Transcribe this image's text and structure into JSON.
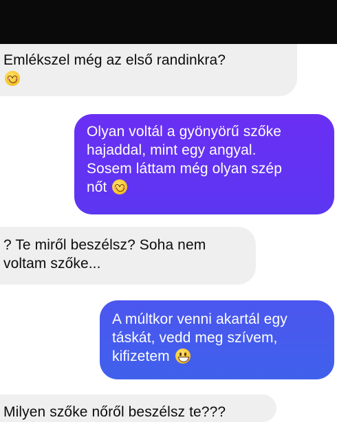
{
  "messages": [
    {
      "from": "them",
      "lines": [
        "Emlékszel még az első randinkra?"
      ],
      "emoji": "smiling-face-with-smiling-eyes"
    },
    {
      "from": "me",
      "lines": [
        "Olyan voltál a gyönyörű szőke",
        "hajaddal, mint egy angyal.",
        "Sosem láttam még olyan szép",
        "nőt"
      ],
      "emoji": "smiling-face-with-smiling-eyes"
    },
    {
      "from": "them",
      "lines": [
        "? Te miről beszélsz? Soha nem",
        "voltam szőke..."
      ]
    },
    {
      "from": "me",
      "lines": [
        "A múltkor venni akartál egy",
        "táskát, vedd meg szívem,",
        "kifizetem"
      ],
      "emoji": "grinning-face"
    },
    {
      "from": "them",
      "lines": [
        "Milyen szőke nőről beszélsz te???"
      ]
    }
  ],
  "colors": {
    "incoming_bubble": "#efefef",
    "outgoing_bubble_1": "#6a2ff3",
    "outgoing_bubble_2": "#4c56ee",
    "top_bar": "#0a0a0a"
  }
}
